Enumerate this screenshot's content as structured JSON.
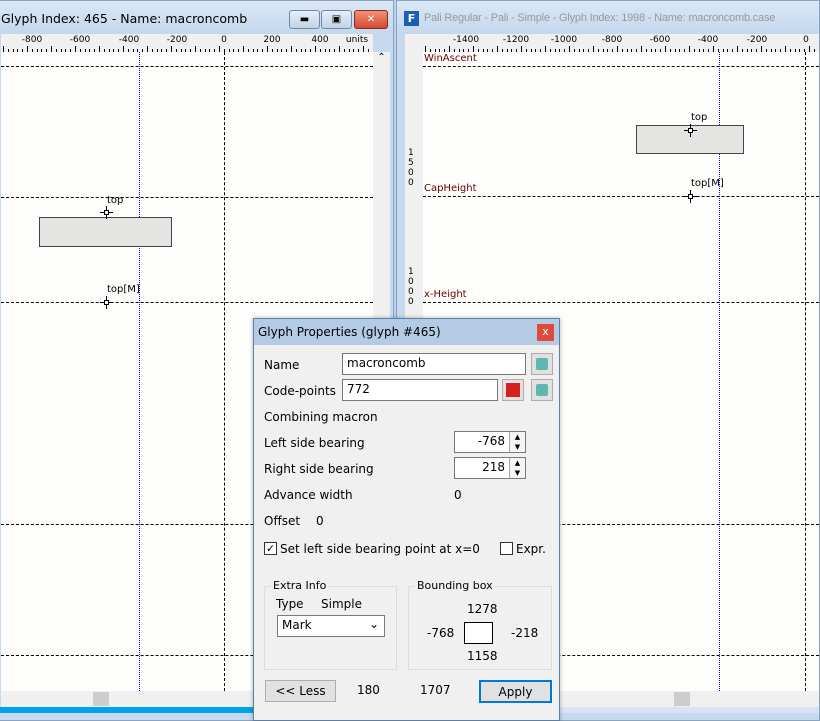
{
  "left_window": {
    "title": "Glyph Index: 465 - Name: macroncomb",
    "ruler_labels": [
      "-800",
      "-600",
      "-400",
      "-200",
      "0",
      "200",
      "400",
      "units"
    ],
    "anchors": [
      {
        "label": "top"
      },
      {
        "label": "top[M]"
      }
    ]
  },
  "right_window": {
    "title": "Pali Regular - Pali - Simple - Glyph Index: 1998 - Name: macroncomb.case",
    "ruler_labels": [
      "-1400",
      "-1200",
      "-1000",
      "-800",
      "-600",
      "-400",
      "-200",
      "0"
    ],
    "vruler_labels": [
      "1500",
      "1000"
    ],
    "guidelines": [
      "WinAscent",
      "CapHeight",
      "x-Height"
    ],
    "anchors": [
      {
        "label": "top"
      },
      {
        "label": "top[M]"
      }
    ]
  },
  "dialog": {
    "title": "Glyph Properties (glyph #465)",
    "close": "x",
    "name_label": "Name",
    "name_value": "macroncomb",
    "codepoints_label": "Code-points",
    "codepoints_value": "772",
    "unicode_name": "Combining macron",
    "lsb_label": "Left side bearing",
    "lsb_value": "-768",
    "rsb_label": "Right side bearing",
    "rsb_value": "218",
    "advance_label": "Advance width",
    "advance_value": "0",
    "offset_label": "Offset",
    "offset_value": "0",
    "set_lsb_label": "Set left side bearing point at x=0",
    "set_lsb_checked": true,
    "expr_label": "Expr.",
    "expr_checked": false,
    "extra_info": {
      "legend": "Extra Info",
      "type_label": "Type",
      "type_value": "Simple",
      "class_value": "Mark"
    },
    "bbox": {
      "legend": "Bounding box",
      "top": "1278",
      "left": "-768",
      "right": "-218",
      "bottom": "1158"
    },
    "less_label": "<< Less",
    "stat1": "180",
    "stat2": "1707",
    "apply_label": "Apply"
  },
  "colors": {
    "guide_blue": "#0000ff",
    "close_red": "#e04a3a",
    "apply_border": "#0078d7"
  }
}
